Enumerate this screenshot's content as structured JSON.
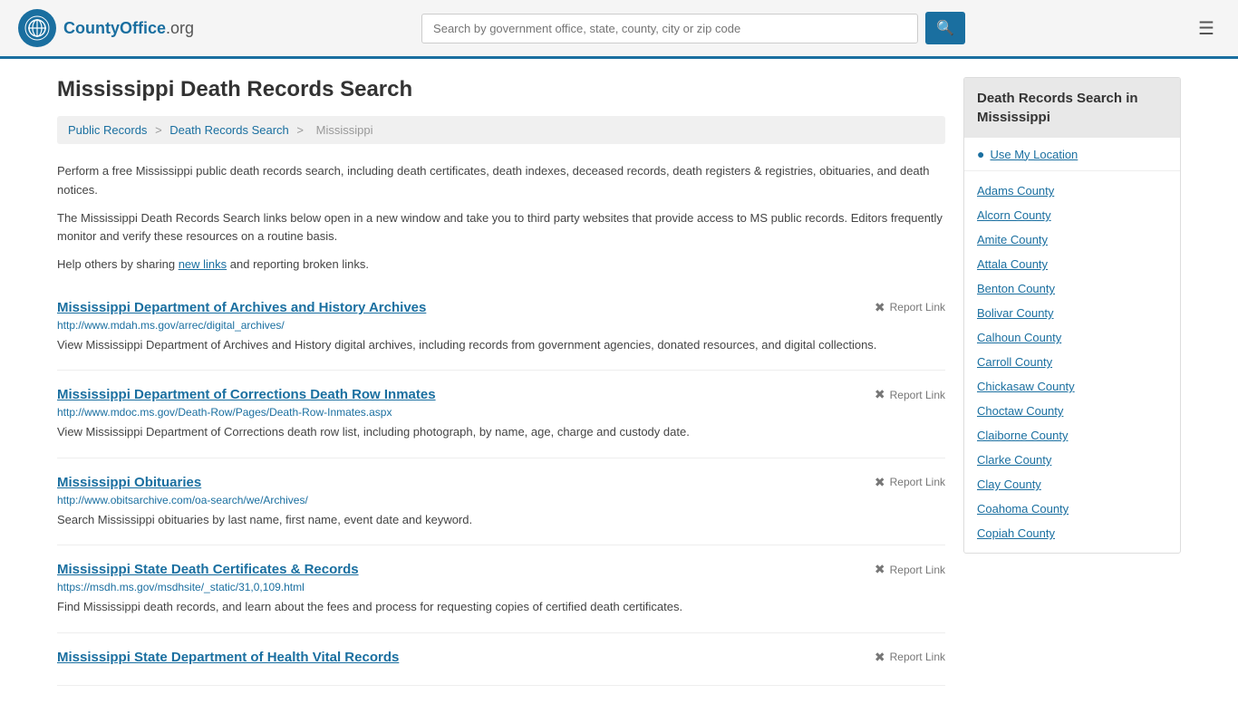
{
  "header": {
    "logo_text": "CountyOffice",
    "logo_suffix": ".org",
    "search_placeholder": "Search by government office, state, county, city or zip code",
    "search_icon": "🔍"
  },
  "page": {
    "title": "Mississippi Death Records Search",
    "breadcrumb": {
      "items": [
        "Public Records",
        "Death Records Search",
        "Mississippi"
      ]
    },
    "intro": {
      "paragraph1": "Perform a free Mississippi public death records search, including death certificates, death indexes, deceased records, death registers & registries, obituaries, and death notices.",
      "paragraph2": "The Mississippi Death Records Search links below open in a new window and take you to third party websites that provide access to MS public records. Editors frequently monitor and verify these resources on a routine basis.",
      "paragraph3_before": "Help others by sharing ",
      "paragraph3_link": "new links",
      "paragraph3_after": " and reporting broken links."
    },
    "results": [
      {
        "title": "Mississippi Department of Archives and History Archives",
        "url": "http://www.mdah.ms.gov/arrec/digital_archives/",
        "description": "View Mississippi Department of Archives and History digital archives, including records from government agencies, donated resources, and digital collections.",
        "report_label": "Report Link"
      },
      {
        "title": "Mississippi Department of Corrections Death Row Inmates",
        "url": "http://www.mdoc.ms.gov/Death-Row/Pages/Death-Row-Inmates.aspx",
        "description": "View Mississippi Department of Corrections death row list, including photograph, by name, age, charge and custody date.",
        "report_label": "Report Link"
      },
      {
        "title": "Mississippi Obituaries",
        "url": "http://www.obitsarchive.com/oa-search/we/Archives/",
        "description": "Search Mississippi obituaries by last name, first name, event date and keyword.",
        "report_label": "Report Link"
      },
      {
        "title": "Mississippi State Death Certificates & Records",
        "url": "https://msdh.ms.gov/msdhsite/_static/31,0,109.html",
        "description": "Find Mississippi death records, and learn about the fees and process for requesting copies of certified death certificates.",
        "report_label": "Report Link"
      },
      {
        "title": "Mississippi State Department of Health Vital Records",
        "url": "",
        "description": "",
        "report_label": "Report Link"
      }
    ]
  },
  "sidebar": {
    "title": "Death Records Search in Mississippi",
    "use_my_location": "Use My Location",
    "counties": [
      "Adams County",
      "Alcorn County",
      "Amite County",
      "Attala County",
      "Benton County",
      "Bolivar County",
      "Calhoun County",
      "Carroll County",
      "Chickasaw County",
      "Choctaw County",
      "Claiborne County",
      "Clarke County",
      "Clay County",
      "Coahoma County",
      "Copiah County"
    ]
  }
}
